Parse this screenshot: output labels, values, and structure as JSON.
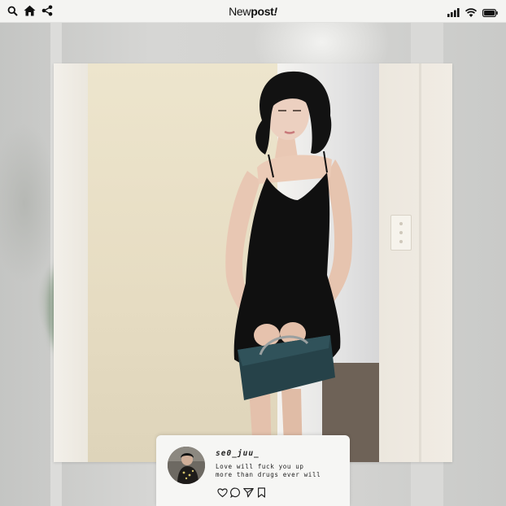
{
  "status_bar": {
    "left_icons": [
      "search-icon",
      "home-icon",
      "share-icon"
    ],
    "title_regular": "New",
    "title_bold": "post",
    "title_mark": "!",
    "right_icons": [
      "signal-icon",
      "wifi-icon",
      "battery-icon"
    ]
  },
  "photo": {
    "subject": "photo-post-image"
  },
  "post": {
    "username": "se0_juu_",
    "caption_line1": "Love will fuck you up",
    "caption_line2": "more than drugs ever will",
    "action_icons": [
      "heart-icon",
      "comment-icon",
      "send-icon",
      "bookmark-icon"
    ]
  },
  "colors": {
    "status_bar_bg": "#f4f4f2",
    "card_bg": "#f6f6f4",
    "text": "#222222",
    "backdrop": "#cfcfcd"
  }
}
